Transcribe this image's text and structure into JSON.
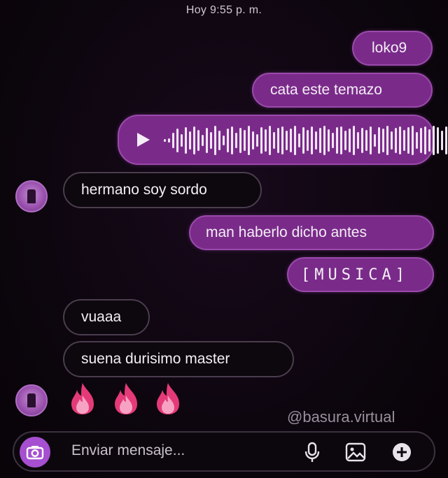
{
  "status": {
    "timestamp": "Hoy 9:55 p. m."
  },
  "messages": {
    "sent_1": "loko9",
    "sent_2": "cata este temazo",
    "received_1": "hermano soy sordo",
    "sent_3": "man haberlo dicho antes",
    "sent_4": "[MUSICA]",
    "received_2": "vuaaa",
    "received_3": "suena durisimo master",
    "reaction_icons": [
      "fire-icon",
      "fire-icon",
      "fire-icon"
    ]
  },
  "voice_note": {
    "icon": "play-icon"
  },
  "watermark": "@basura.virtual",
  "composer": {
    "placeholder": "Enviar mensaje...",
    "icons": [
      "camera-icon",
      "microphone-icon",
      "image-icon",
      "plus-icon"
    ]
  },
  "colors": {
    "background": "#0c060d",
    "sent_bubble": "#7a2b8a",
    "received_border": "#4a3d4d",
    "camera_button": "#a64fd0"
  }
}
